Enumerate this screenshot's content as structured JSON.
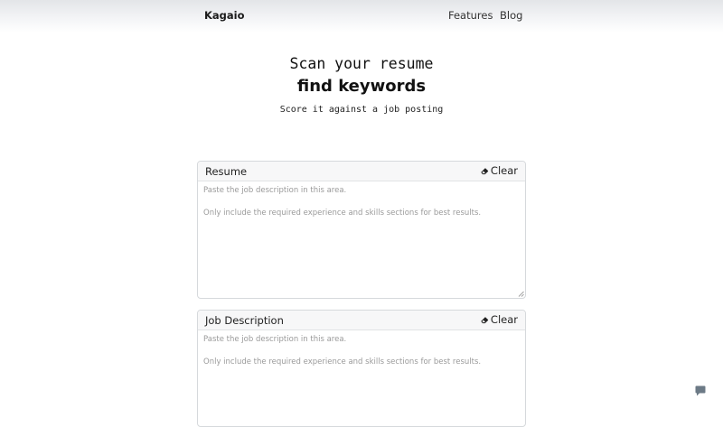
{
  "nav": {
    "brand": "Kagaio",
    "links": [
      "Features",
      "Blog"
    ]
  },
  "hero": {
    "line1": "Scan your resume",
    "line2": "find keywords",
    "subtitle": "Score it against a job posting"
  },
  "cards": [
    {
      "title": "Resume",
      "clear_label": "Clear",
      "placeholder": "Paste the job description in this area.\n\nOnly include the required experience and skills sections for best results."
    },
    {
      "title": "Job Description",
      "clear_label": "Clear",
      "placeholder": "Paste the job description in this area.\n\nOnly include the required experience and skills sections for best results."
    }
  ],
  "icons": {
    "clear": "eraser-icon",
    "chat": "chat-icon"
  },
  "colors": {
    "chat_button": "#6c7a86"
  }
}
